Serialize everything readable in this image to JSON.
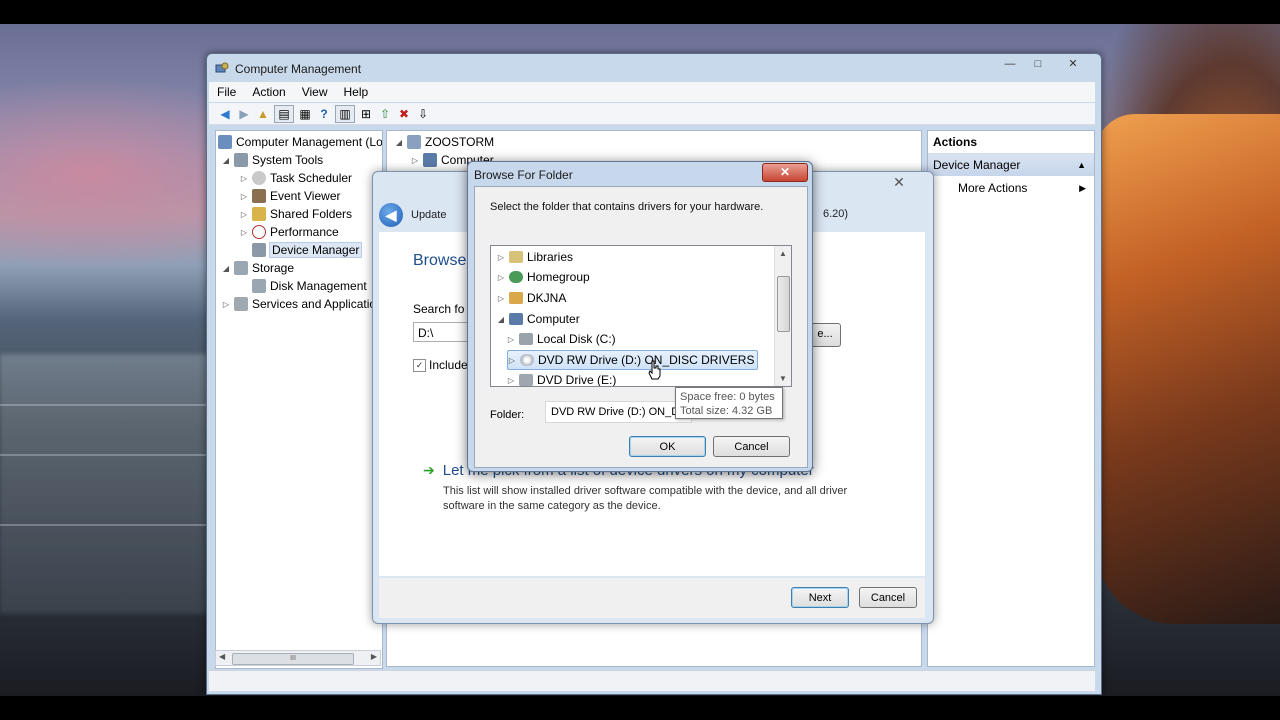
{
  "main_window": {
    "title": "Computer Management",
    "window_buttons": [
      "—",
      "□",
      "✕"
    ],
    "menu": [
      "File",
      "Action",
      "View",
      "Help"
    ],
    "tree": [
      {
        "label": "Computer Management (Lo",
        "level": 0
      },
      {
        "label": "System Tools",
        "level": 1
      },
      {
        "label": "Task Scheduler",
        "level": 2
      },
      {
        "label": "Event Viewer",
        "level": 2
      },
      {
        "label": "Shared Folders",
        "level": 2
      },
      {
        "label": "Performance",
        "level": 2
      },
      {
        "label": "Device Manager",
        "level": 2
      },
      {
        "label": "Storage",
        "level": 1
      },
      {
        "label": "Disk Management",
        "level": 2
      },
      {
        "label": "Services and Applicatio",
        "level": 1
      }
    ],
    "center": {
      "root": "ZOOSTORM",
      "child": "Computer"
    },
    "actions": {
      "header": "Actions",
      "section": "Device Manager",
      "more": "More Actions"
    }
  },
  "wizard": {
    "caption": "Update",
    "caption_right": "6.20)",
    "heading": "Browse",
    "search_label": "Search fo",
    "path_value": "D:\\",
    "browse_button": "e...",
    "include_label": "Include",
    "pick_title": "Let me pick from a list of device drivers on my computer",
    "pick_desc": "This list will show installed driver software compatible with the device, and all driver software in the same category as the device.",
    "next_button": "Next",
    "cancel_button": "Cancel"
  },
  "browse_dialog": {
    "title": "Browse For Folder",
    "instruction": "Select the folder that contains drivers for your hardware.",
    "folders": [
      {
        "label": "Libraries",
        "level": 0,
        "expander": "▷"
      },
      {
        "label": "Homegroup",
        "level": 0,
        "expander": "▷"
      },
      {
        "label": "DKJNA",
        "level": 0,
        "expander": "▷"
      },
      {
        "label": "Computer",
        "level": 0,
        "expander": "◢"
      },
      {
        "label": "Local Disk (C:)",
        "level": 1,
        "expander": "▷"
      },
      {
        "label": "DVD RW Drive (D:) ON_DISC DRIVERS",
        "level": 1,
        "expander": "▷",
        "selected": true
      },
      {
        "label": "DVD Drive (E:)",
        "level": 1,
        "expander": "▷"
      }
    ],
    "folder_label": "Folder:",
    "folder_value": "DVD RW Drive (D:) ON_D",
    "ok_button": "OK",
    "cancel_button": "Cancel"
  },
  "tooltip": {
    "line1": "Space free: 0 bytes",
    "line2": "Total size: 4.32 GB"
  },
  "colors": {
    "accent_blue": "#1e4e8c",
    "selection": "#cfe2f7",
    "close_red": "#c84532"
  }
}
